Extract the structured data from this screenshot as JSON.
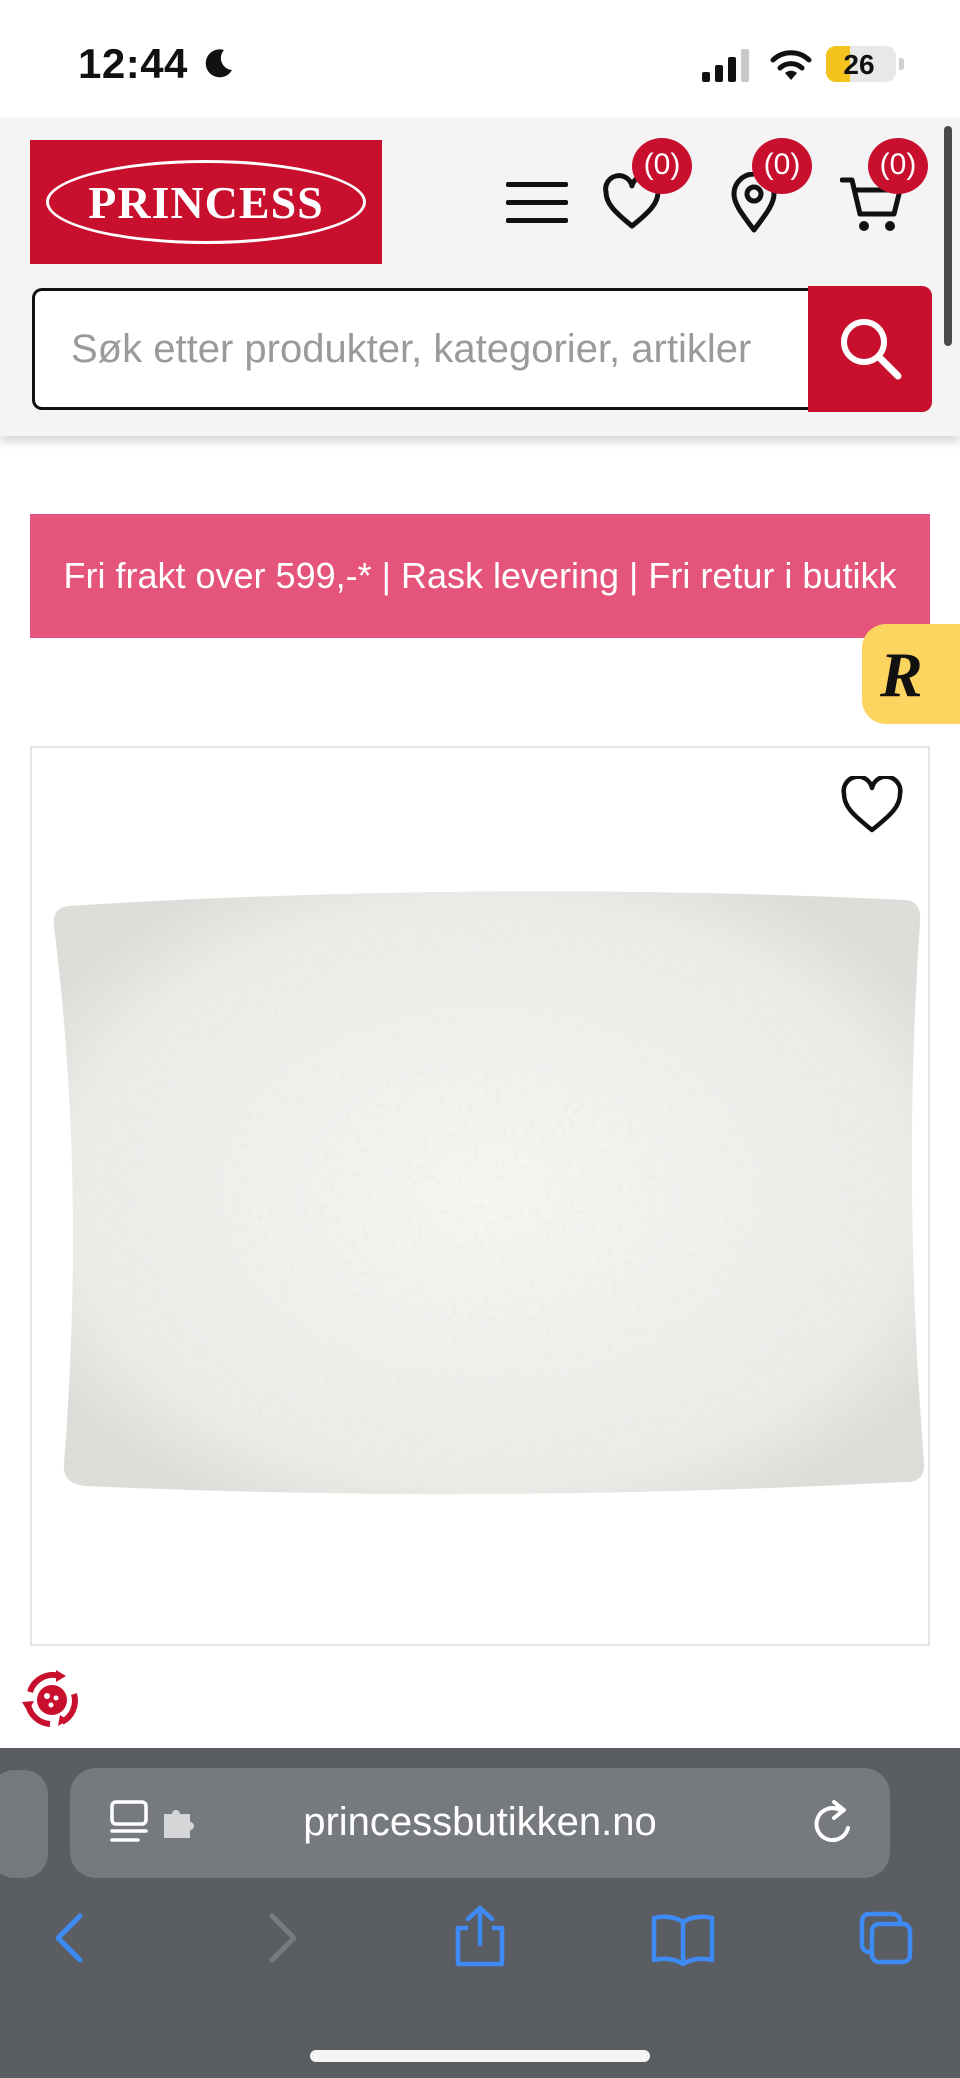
{
  "status_bar": {
    "time": "12:44",
    "battery_level": "26",
    "icons": [
      "moon-icon",
      "cellular-signal-icon",
      "wifi-icon",
      "battery-icon"
    ]
  },
  "header": {
    "logo_text": "PRINCESS",
    "brand_color": "#c8102e",
    "wishlist_count": "(0)",
    "stores_count": "(0)",
    "cart_count": "(0)",
    "icons": [
      "menu-icon",
      "heart-icon",
      "location-pin-icon",
      "cart-icon",
      "search-icon"
    ]
  },
  "search": {
    "placeholder": "Søk etter produkter, kategorier, artikler"
  },
  "promo": {
    "text": "Fri frakt over 599,-* | Rask levering | Fri retur i butikk",
    "color": "#e5547a"
  },
  "side_badge": {
    "letter": "R",
    "color": "#fbd560"
  },
  "product": {
    "icons": [
      "heart-outline-icon"
    ]
  },
  "browser": {
    "url": "princessbutikken.no",
    "icons": [
      "reader-icon",
      "extension-icon",
      "reload-icon",
      "back-icon",
      "forward-icon",
      "share-icon",
      "bookmarks-icon",
      "tabs-icon"
    ]
  }
}
